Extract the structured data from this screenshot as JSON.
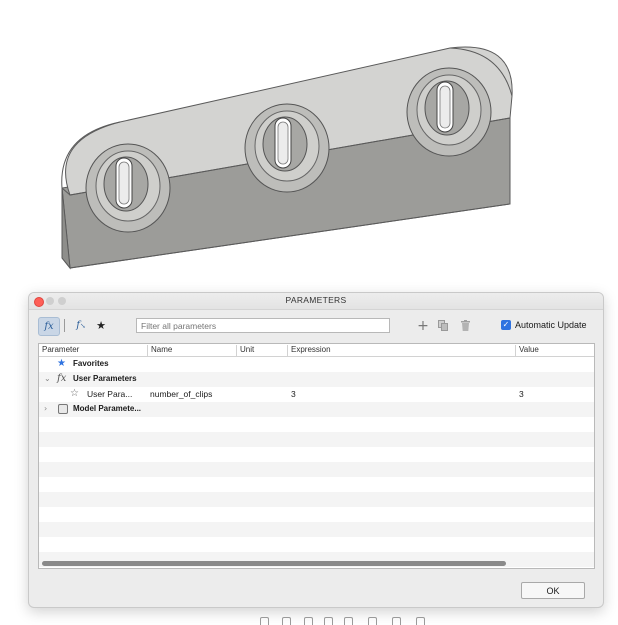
{
  "dialog": {
    "title": "PARAMETERS",
    "toolbar": {
      "fx_label": "fx",
      "fx_sub_label": "f",
      "favorites_glyph": "★",
      "filter_placeholder": "Filter all parameters",
      "add_glyph": "+",
      "auto_update_label": "Automatic Update",
      "auto_update_checked": true
    },
    "columns": [
      "Parameter",
      "Name",
      "Unit",
      "Expression",
      "Value"
    ],
    "rows": [
      {
        "type": "group",
        "label": "Favorites",
        "icon": "star-icon",
        "expandable": false
      },
      {
        "type": "group",
        "label": "User Parameters",
        "icon": "fx-icon",
        "expanded": true,
        "arrow": "⌄"
      },
      {
        "type": "item",
        "label": "User Para...",
        "icon": "star-outline-icon",
        "name": "number_of_clips",
        "unit": "",
        "expression": "3",
        "value": "3"
      },
      {
        "type": "group",
        "label": "Model Paramete...",
        "icon": "model-icon",
        "expanded": false,
        "arrow": "›"
      }
    ],
    "ok_label": "OK"
  },
  "colors": {
    "accent": "#2f73e0",
    "part_face": "#d3d3d1",
    "part_edge": "#555555"
  }
}
